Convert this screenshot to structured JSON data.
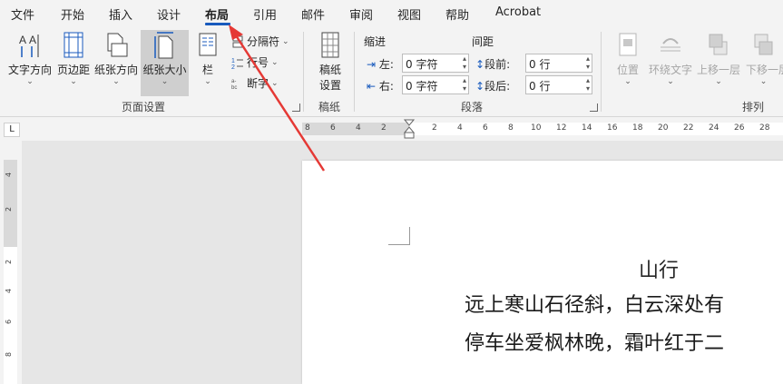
{
  "menu": {
    "tabs": [
      "文件",
      "开始",
      "插入",
      "设计",
      "布局",
      "引用",
      "邮件",
      "审阅",
      "视图",
      "帮助",
      "Acrobat"
    ],
    "active": "布局"
  },
  "ribbon": {
    "page_setup": {
      "text_direction": "文字方向",
      "margins": "页边距",
      "orientation": "纸张方向",
      "size": "纸张大小",
      "columns": "栏",
      "breaks": "分隔符",
      "line_numbers": "行号",
      "hyphenation": "断字",
      "group_label": "页面设置"
    },
    "manuscript": {
      "button": "稿纸\n设置",
      "button_line1": "稿纸",
      "button_line2": "设置",
      "group_label": "稿纸"
    },
    "paragraph": {
      "indent_header": "缩进",
      "spacing_header": "间距",
      "left_label": "左:",
      "left_value": "0 字符",
      "right_label": "右:",
      "right_value": "0 字符",
      "before_label": "段前:",
      "before_value": "0 行",
      "after_label": "段后:",
      "after_value": "0 行",
      "group_label": "段落"
    },
    "arrange": {
      "position": "位置",
      "wrap_text": "环绕文字",
      "bring_forward": "上移一层",
      "send_backward": "下移一层",
      "group_label": "排列"
    }
  },
  "ruler": {
    "left_numbers": [
      "8",
      "6",
      "4",
      "2"
    ],
    "right_numbers": [
      "2",
      "4",
      "6",
      "8",
      "10",
      "12",
      "14",
      "16",
      "18",
      "20",
      "22",
      "24",
      "26",
      "28"
    ],
    "vertical_numbers": [
      "4",
      "2",
      "2",
      "4",
      "6",
      "8"
    ],
    "tab_selector": "L"
  },
  "document": {
    "title": "山行",
    "lines": [
      "远上寒山石径斜，白云深处有",
      "停车坐爱枫林晚，霜叶红于二"
    ]
  },
  "colors": {
    "accent": "#185abd",
    "arrow": "#e53935"
  }
}
